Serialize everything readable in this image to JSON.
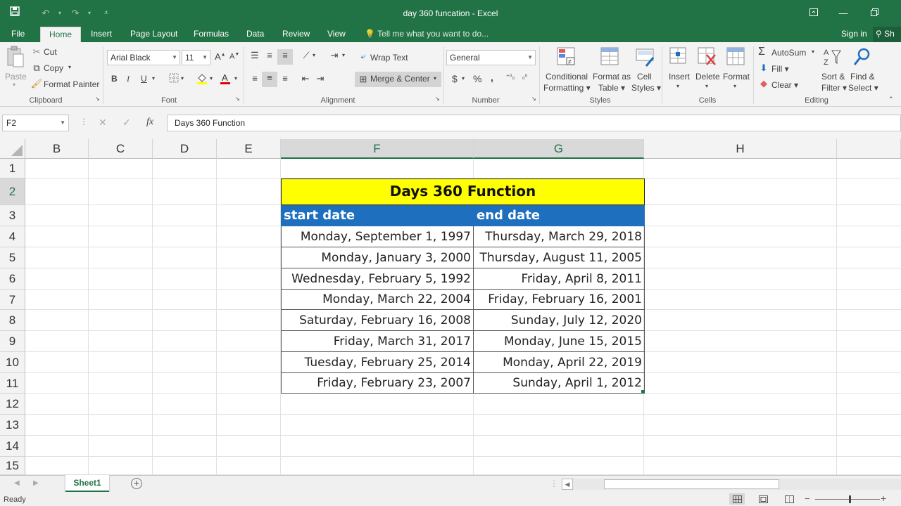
{
  "window": {
    "title": "day 360 funcation - Excel"
  },
  "tabs": [
    "File",
    "Home",
    "Insert",
    "Page Layout",
    "Formulas",
    "Data",
    "Review",
    "View"
  ],
  "tell_me": "Tell me what you want to do...",
  "account": {
    "sign_in": "Sign in",
    "share": "Sh"
  },
  "clipboard": {
    "paste": "Paste",
    "cut": "Cut",
    "copy": "Copy",
    "format_painter": "Format Painter",
    "label": "Clipboard"
  },
  "font": {
    "name": "Arial Black",
    "size": "11",
    "bold": "B",
    "italic": "I",
    "underline": "U",
    "label": "Font"
  },
  "alignment": {
    "wrap": "Wrap Text",
    "merge": "Merge & Center",
    "label": "Alignment"
  },
  "number": {
    "format": "General",
    "currency": "$",
    "percent": "%",
    "comma": ",",
    "label": "Number"
  },
  "styles": {
    "conditional": "Conditional",
    "conditional2": "Formatting",
    "format_as": "Format as",
    "format_as2": "Table",
    "cell": "Cell",
    "cell2": "Styles",
    "label": "Styles"
  },
  "cells": {
    "insert": "Insert",
    "delete": "Delete",
    "format": "Format",
    "label": "Cells"
  },
  "editing": {
    "autosum": "AutoSum",
    "fill": "Fill",
    "clear": "Clear",
    "sort": "Sort &",
    "sort2": "Filter",
    "find": "Find &",
    "find2": "Select",
    "label": "Editing"
  },
  "formula_bar": {
    "name_box": "F2",
    "formula": "Days 360  Function"
  },
  "columns": [
    "B",
    "C",
    "D",
    "E",
    "F",
    "G",
    "H"
  ],
  "rows": [
    "1",
    "2",
    "3",
    "4",
    "5",
    "6",
    "7",
    "8",
    "9",
    "10",
    "11",
    "12",
    "13",
    "14",
    "15"
  ],
  "table": {
    "title": "Days 360  Function",
    "header_start": "start date",
    "header_end": "end date",
    "title_bg": "#ffff00",
    "header_bg": "#1f6fbf",
    "rows": [
      {
        "start": "Monday, September 1, 1997",
        "end": "Thursday, March 29, 2018"
      },
      {
        "start": "Monday, January 3, 2000",
        "end": "Thursday, August 11, 2005"
      },
      {
        "start": "Wednesday, February 5, 1992",
        "end": "Friday, April 8, 2011"
      },
      {
        "start": "Monday, March 22, 2004",
        "end": "Friday, February 16, 2001"
      },
      {
        "start": "Saturday, February 16, 2008",
        "end": "Sunday, July 12, 2020"
      },
      {
        "start": "Friday, March 31, 2017",
        "end": "Monday, June 15, 2015"
      },
      {
        "start": "Tuesday, February 25, 2014",
        "end": "Monday, April 22, 2019"
      },
      {
        "start": "Friday, February 23, 2007",
        "end": "Sunday, April 1, 2012"
      }
    ]
  },
  "sheet": {
    "tab": "Sheet1"
  },
  "status": {
    "ready": "Ready"
  },
  "accent": "#217346"
}
